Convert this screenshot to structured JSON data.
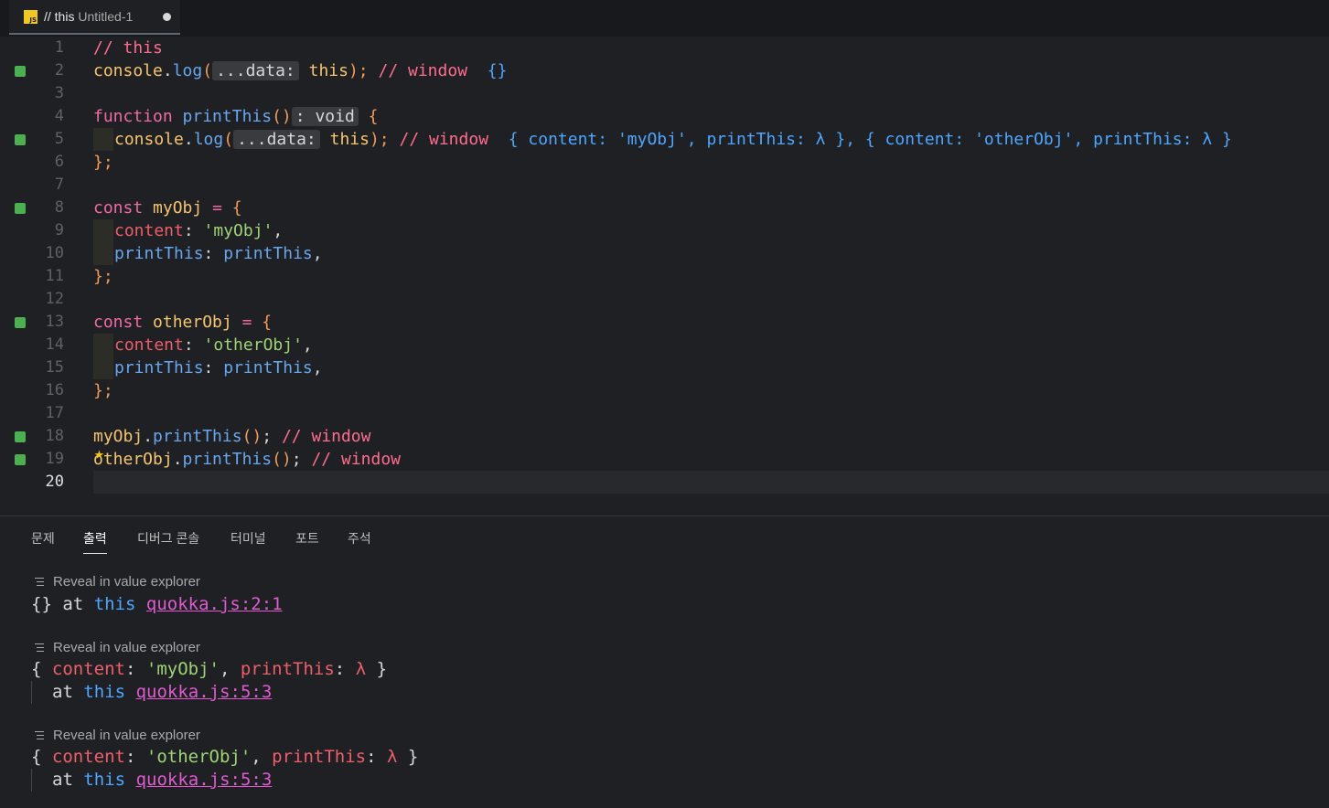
{
  "tab": {
    "title_this": "// this",
    "title_file": "Untitled-1",
    "icon_text": "JS"
  },
  "code": {
    "l1": "// this",
    "l2_obj": "console",
    "l2_dot": ".",
    "l2_fn": "log",
    "l2_open": "(",
    "l2_hint": "...data:",
    "l2_arg": "this",
    "l2_close": ");",
    "l2_comment": "// window",
    "l2_result": "{}",
    "l4_kw": "function",
    "l4_name": "printThis",
    "l4_parens": "()",
    "l4_hint": ": void",
    "l4_brace": "{",
    "l5_comment": "// window",
    "l5_result": "{ content: 'myObj', printThis: λ }, { content: 'otherObj', printThis: λ }",
    "l6": "};",
    "const_kw": "const",
    "l8_name": "myObj",
    "eq": "=",
    "open_brace": "{",
    "content_key": "content",
    "colon": ":",
    "l9_val": "'myObj'",
    "comma": ",",
    "print_key": "printThis",
    "print_val": "printThis",
    "l13_name": "otherObj",
    "l14_val": "'otherObj'",
    "l18_obj": "myObj",
    "l18_call": "printThis",
    "call_parens": "()",
    "semi": ";",
    "l18_comment": "// window",
    "l19_obj": "otherObj",
    "l19_comment": "// window"
  },
  "line_numbers": [
    "1",
    "2",
    "3",
    "4",
    "5",
    "6",
    "7",
    "8",
    "9",
    "10",
    "11",
    "12",
    "13",
    "14",
    "15",
    "16",
    "17",
    "18",
    "19",
    "20"
  ],
  "panel": {
    "tabs": [
      "문제",
      "출력",
      "디버그 콘솔",
      "터미널",
      "포트",
      "주석"
    ],
    "reveal_text": "Reveal in value explorer",
    "out1": {
      "val": "{}",
      "at": "at",
      "this": "this",
      "link": "quokka.js:2:1"
    },
    "out2": {
      "open": "{",
      "key": "content",
      "val": "'myObj'",
      "key2": "printThis",
      "lambda": "λ",
      "close": "}",
      "at": "at",
      "this": "this",
      "link": "quokka.js:5:3"
    },
    "out3": {
      "open": "{",
      "key": "content",
      "val": "'otherObj'",
      "key2": "printThis",
      "lambda": "λ",
      "close": "}",
      "at": "at",
      "this": "this",
      "link": "quokka.js:5:3"
    }
  }
}
